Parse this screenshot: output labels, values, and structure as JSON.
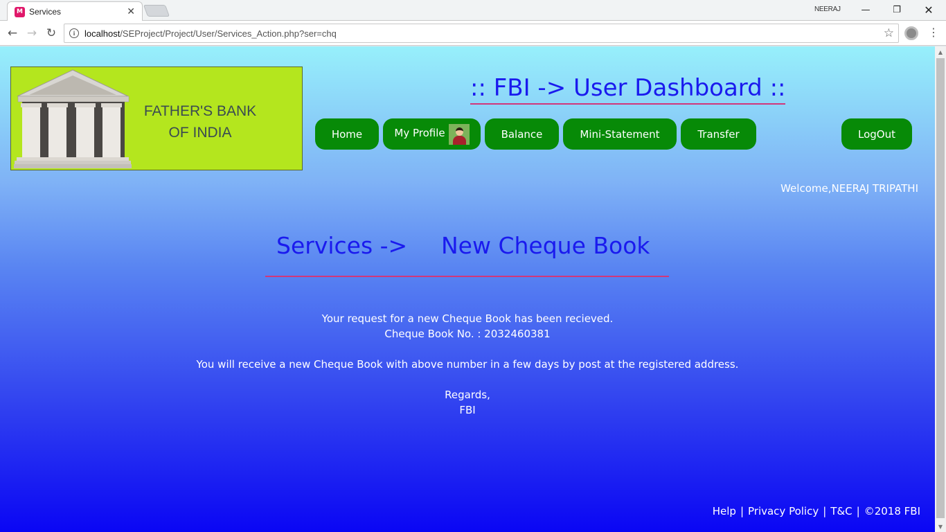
{
  "browser": {
    "tab_title": "Services",
    "tab_favicon": "M",
    "profile_name": "NEERAJ",
    "url_host": "localhost",
    "url_path": "/SEProject/Project/User/Services_Action.php?ser=chq"
  },
  "header": {
    "logo_line1": "FATHER'S BANK",
    "logo_line2": "OF INDIA",
    "dashboard_title": ":: FBI -> User Dashboard ::"
  },
  "nav": {
    "home": "Home",
    "my_profile": "My Profile",
    "balance": "Balance",
    "mini_statement": "Mini-Statement",
    "transfer": "Transfer",
    "logout": "LogOut"
  },
  "welcome": "Welcome,NEERAJ TRIPATHI",
  "services": {
    "crumb": "Services ->",
    "page": "New Cheque Book"
  },
  "message": {
    "line1": "Your request for a new Cheque Book has been recieved.",
    "line2": "Cheque Book No. : 2032460381",
    "line3": "You will receive a new Cheque Book with above number in a few days by post at the registered address.",
    "line4": "Regards,",
    "line5": "FBI"
  },
  "footer": {
    "help": "Help",
    "privacy": "Privacy Policy",
    "tnc": "T&C",
    "copyright": "©2018 FBI",
    "separator": "|"
  },
  "colors": {
    "nav_button": "#078a07",
    "title_blue": "#1a1aee",
    "underline_pink": "#d2367a",
    "logo_bg": "#b4e61e"
  }
}
